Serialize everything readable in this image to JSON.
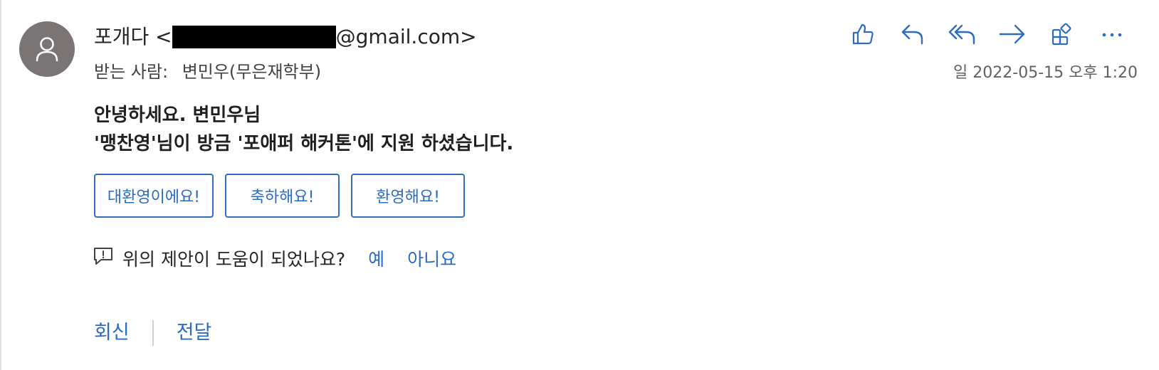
{
  "sender": {
    "name_prefix": "포개다 <",
    "email_suffix": "@gmail.com>",
    "avatar_icon": "person-icon"
  },
  "recipient": {
    "label": "받는 사람:",
    "name": "변민우(무은재학부)"
  },
  "datetime": "일 2022-05-15 오후 1:20",
  "toolbar": {
    "icons": [
      "like-icon",
      "reply-icon",
      "reply-all-icon",
      "forward-icon",
      "apps-icon",
      "more-icon"
    ]
  },
  "body": {
    "line1": "안녕하세요. 변민우님",
    "line2": "'맹찬영'님이 방금 '포애퍼 해커톤'에 지원 하셨습니다."
  },
  "suggested_replies": [
    "대환영이에요!",
    "축하해요!",
    "환영해요!"
  ],
  "feedback": {
    "question": "위의 제안이 도움이 되었나요?",
    "yes": "예",
    "no": "아니요"
  },
  "footer": {
    "reply": "회신",
    "forward": "전달"
  },
  "colors": {
    "accent": "#2b6cbf",
    "avatar_bg": "#7a7574",
    "text": "#242424",
    "muted": "#616161"
  }
}
